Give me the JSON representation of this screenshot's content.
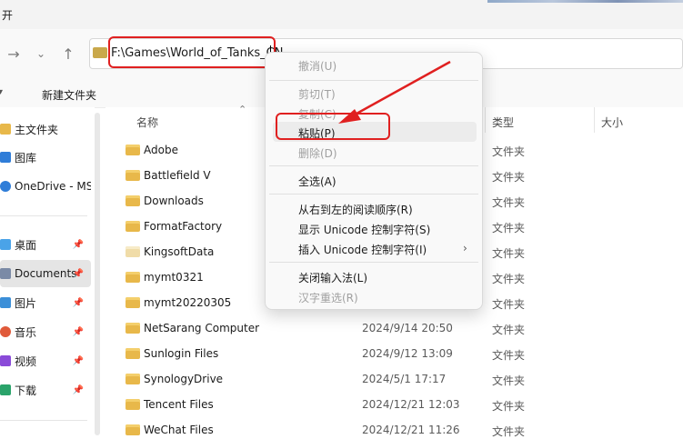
{
  "window": {
    "title_fragment": "开"
  },
  "address_bar": {
    "path": "F:\\Games\\World_of_Tanks_CN"
  },
  "command_bar": {
    "new_folder": "新建文件夹"
  },
  "sidebar": {
    "items": [
      {
        "label": "主文件夹",
        "icon": "home-icon",
        "color": "#e8b84a"
      },
      {
        "label": "图库",
        "icon": "gallery-icon",
        "color": "#2f7dd8"
      },
      {
        "label": "OneDrive - MS",
        "icon": "cloud-icon",
        "color": "#2f7dd8"
      },
      {
        "label": "桌面",
        "icon": "desktop-icon",
        "color": "#4aa3e8"
      },
      {
        "label": "Documents",
        "icon": "documents-icon",
        "color": "#7a8aa6"
      },
      {
        "label": "图片",
        "icon": "pictures-icon",
        "color": "#3b8fd8"
      },
      {
        "label": "音乐",
        "icon": "music-icon",
        "color": "#e05a3a"
      },
      {
        "label": "视频",
        "icon": "videos-icon",
        "color": "#8a4ad8"
      },
      {
        "label": "下载",
        "icon": "downloads-icon",
        "color": "#2aa36a"
      }
    ]
  },
  "list": {
    "columns": {
      "name": "名称",
      "date": "",
      "type": "类型",
      "size": "大小"
    },
    "rows": [
      {
        "name": "Adobe",
        "date": "",
        "type": "文件夹"
      },
      {
        "name": "Battlefield V",
        "date": "",
        "type": "文件夹"
      },
      {
        "name": "Downloads",
        "date": "",
        "type": "文件夹"
      },
      {
        "name": "FormatFactory",
        "date": "",
        "type": "文件夹"
      },
      {
        "name": "KingsoftData",
        "date": "",
        "type": "文件夹"
      },
      {
        "name": "mymt0321",
        "date": "",
        "type": "文件夹"
      },
      {
        "name": "mymt20220305",
        "date": "",
        "type": "文件夹"
      },
      {
        "name": "NetSarang Computer",
        "date": "2024/9/14 20:50",
        "type": "文件夹"
      },
      {
        "name": "Sunlogin Files",
        "date": "2024/9/12 13:09",
        "type": "文件夹"
      },
      {
        "name": "SynologyDrive",
        "date": "2024/5/1 17:17",
        "type": "文件夹"
      },
      {
        "name": "Tencent Files",
        "date": "2024/12/21 12:03",
        "type": "文件夹"
      },
      {
        "name": "WeChat Files",
        "date": "2024/12/21 11:26",
        "type": "文件夹"
      }
    ]
  },
  "context_menu": {
    "undo": "撤消(U)",
    "cut": "剪切(T)",
    "copy": "复制(C)",
    "paste": "粘贴(P)",
    "delete": "删除(D)",
    "select_all": "全选(A)",
    "rtl": "从右到左的阅读顺序(R)",
    "show_unicode": "显示 Unicode 控制字符(S)",
    "insert_unicode": "插入 Unicode 控制字符(I)",
    "close_ime": "关闭输入法(L)",
    "reconvert": "汉字重选(R)"
  },
  "annotation": {
    "color": "#e02020"
  }
}
